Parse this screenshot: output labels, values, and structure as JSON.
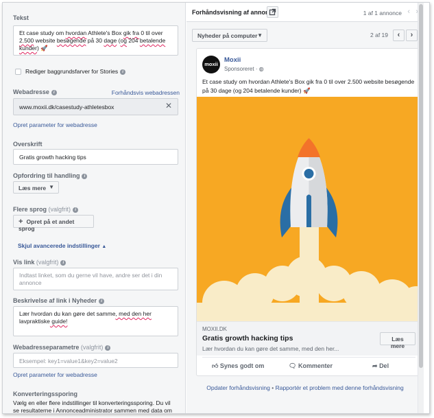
{
  "left": {
    "text_label": "Tekst",
    "text_value_parts": [
      "Et case study om ",
      "hvordan",
      " Athlete's Box ",
      "gik",
      " ",
      "fra",
      " 0 til over ",
      "2.500",
      " website ",
      "besøgende",
      " på 30 ",
      "dage",
      " (",
      "og",
      " 204 ",
      "betalende",
      " ",
      "kunder",
      ")"
    ],
    "text_value_emoji": "🚀",
    "stories_checkbox_label": "Rediger baggrundsfarver for Stories",
    "url_label": "Webadresse",
    "url_preview_link": "Forhåndsvis webadressen",
    "url_value": "www.moxii.dk/casestudy-athletesbox",
    "url_param_link": "Opret parameter for webadresse",
    "headline_label": "Overskrift",
    "headline_value": "Gratis growth hacking tips",
    "cta_label": "Opfordring til handling",
    "cta_value": "Læs mere",
    "languages_label": "Flere sprog",
    "languages_optional": "(valgfrit)",
    "languages_button": "Opret på et andet sprog",
    "advanced_toggle": "Skjul avancerede indstillinger",
    "display_link_label": "Vis link",
    "display_link_optional": "(valgfrit)",
    "display_link_placeholder": "Indtast linket, som du gerne vil have, andre ser det i din annonce",
    "news_desc_label": "Beskrivelse af link i Nyheder",
    "news_desc_parts": [
      "Lær hvordan",
      " ",
      "du",
      " ",
      "kan",
      " ",
      "gøre",
      " ",
      "det",
      " ",
      "samme",
      ", med den her ",
      "lavpraktiske",
      " guide!"
    ],
    "url_params_label": "Webadresseparametre",
    "url_params_optional": "(valgfrit)",
    "url_params_placeholder": "Eksempel: key1=value1&key2=value2",
    "url_params_link": "Opret parameter for webadresse",
    "conversion_label": "Konverteringssporing",
    "conversion_text": "Vælg en eller flere indstillinger til konverteringssporing. Du vil se resultaterne i Annonceadministrator sammen med data om"
  },
  "right": {
    "header_title": "Forhåndsvisning af annonce",
    "header_count": "1 af 1 annonce",
    "placement_select": "Nyheder på computer",
    "page_count": "2 af 19",
    "ad": {
      "page_name": "Moxii",
      "logo_text": "moxii",
      "sponsored": "Sponsoreret",
      "body": "Et case study om hvordan Athlete's Box gik fra 0 til over 2.500 website besøgende på 30 dage (og 204 betalende kunder) 🚀",
      "domain": "MOXII.DK",
      "headline": "Gratis growth hacking tips",
      "description": "Lær hvordan du kan gøre det samme, med den her...",
      "cta": "Læs mere",
      "like": "Synes godt om",
      "comment": "Kommenter",
      "share": "Del"
    },
    "footer_link_1": "Opdater forhåndsvisning",
    "footer_separator": " • ",
    "footer_link_2": "Rapportér et problem med denne forhåndsvisning"
  },
  "colors": {
    "accent": "#385898",
    "image_bg": "#f7a823",
    "rocket_blue": "#2a6ea5",
    "rocket_orange": "#f3732a",
    "cloud": "#f9ecc8"
  }
}
